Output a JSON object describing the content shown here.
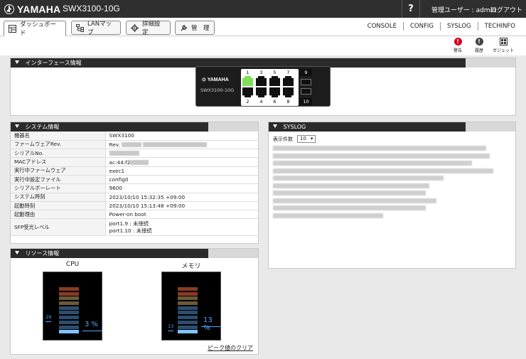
{
  "header": {
    "brand": "YAMAHA",
    "model": "SWX3100-10G",
    "help": "?",
    "user": "管理ユーザー : admin",
    "logout": "ログアウト"
  },
  "nav": {
    "tabs": [
      {
        "label": "ダッシュボード",
        "icon": "dashboard-icon"
      },
      {
        "label": "LANマップ",
        "icon": "lan-map-icon"
      },
      {
        "label": "詳細設定",
        "icon": "gear-icon"
      },
      {
        "label": "管　理",
        "icon": "wrench-icon"
      }
    ],
    "links": [
      "CONSOLE",
      "CONFIG",
      "SYSLOG",
      "TECHINFO"
    ]
  },
  "alerts": [
    {
      "label": "警告",
      "icon": "warning-icon",
      "color": "#d0021b"
    },
    {
      "label": "履歴",
      "icon": "history-icon",
      "color": "#444444"
    },
    {
      "label": "ガジェット",
      "icon": "gadget-icon",
      "color": "#444444"
    }
  ],
  "interface_panel": {
    "title": "インターフェース情報",
    "switch_brand": "YAMAHA",
    "switch_model": "SWX3100-10G",
    "ports_top": [
      "1",
      "3",
      "5",
      "7"
    ],
    "ports_bottom": [
      "2",
      "4",
      "6",
      "8"
    ],
    "sfp_top": "9",
    "sfp_bottom": "10",
    "link_up_port": "1",
    "link_up_color": "#7ee05a"
  },
  "system_panel": {
    "title": "システム情報",
    "rows": [
      {
        "key": "機器名",
        "value": "SWX3100"
      },
      {
        "key": "ファームウェアRev.",
        "value": "Rev."
      },
      {
        "key": "シリアルNo.",
        "value": ""
      },
      {
        "key": "MACアドレス",
        "value": "ac:44:f2"
      },
      {
        "key": "実行中ファームウェア",
        "value": "exec1"
      },
      {
        "key": "実行中設定ファイル",
        "value": "config0"
      },
      {
        "key": "シリアルボーレート",
        "value": "9600"
      },
      {
        "key": "システム時刻",
        "value": "2023/10/10 15:32:35 +09:00"
      },
      {
        "key": "起動時刻",
        "value": "2023/10/10 15:13:48 +09:00"
      },
      {
        "key": "起動理由",
        "value": "Power-on boot"
      }
    ],
    "sfp_key": "SFP受光レベル",
    "sfp_values": [
      "port1.9 : 未接続",
      "port1.10 : 未接続"
    ]
  },
  "syslog_panel": {
    "title": "SYSLOG",
    "count_label": "表示件数",
    "count_value": "10"
  },
  "resource_panel": {
    "title": "リソース情報",
    "cpu": {
      "label": "CPU",
      "peak": "29",
      "value": "3 %",
      "usage_fraction": 0.03,
      "peak_fraction": 0.29
    },
    "memory": {
      "label": "メモリ",
      "peak": "13",
      "value": "13 %",
      "usage_fraction": 0.13,
      "peak_fraction": 0.13
    },
    "clear_link": "ピーク値のクリア",
    "colors": {
      "high": "#8a3a22",
      "mid": "#6b5a3a",
      "low": "#2e4d6e",
      "active": "#7fc3ff"
    }
  }
}
